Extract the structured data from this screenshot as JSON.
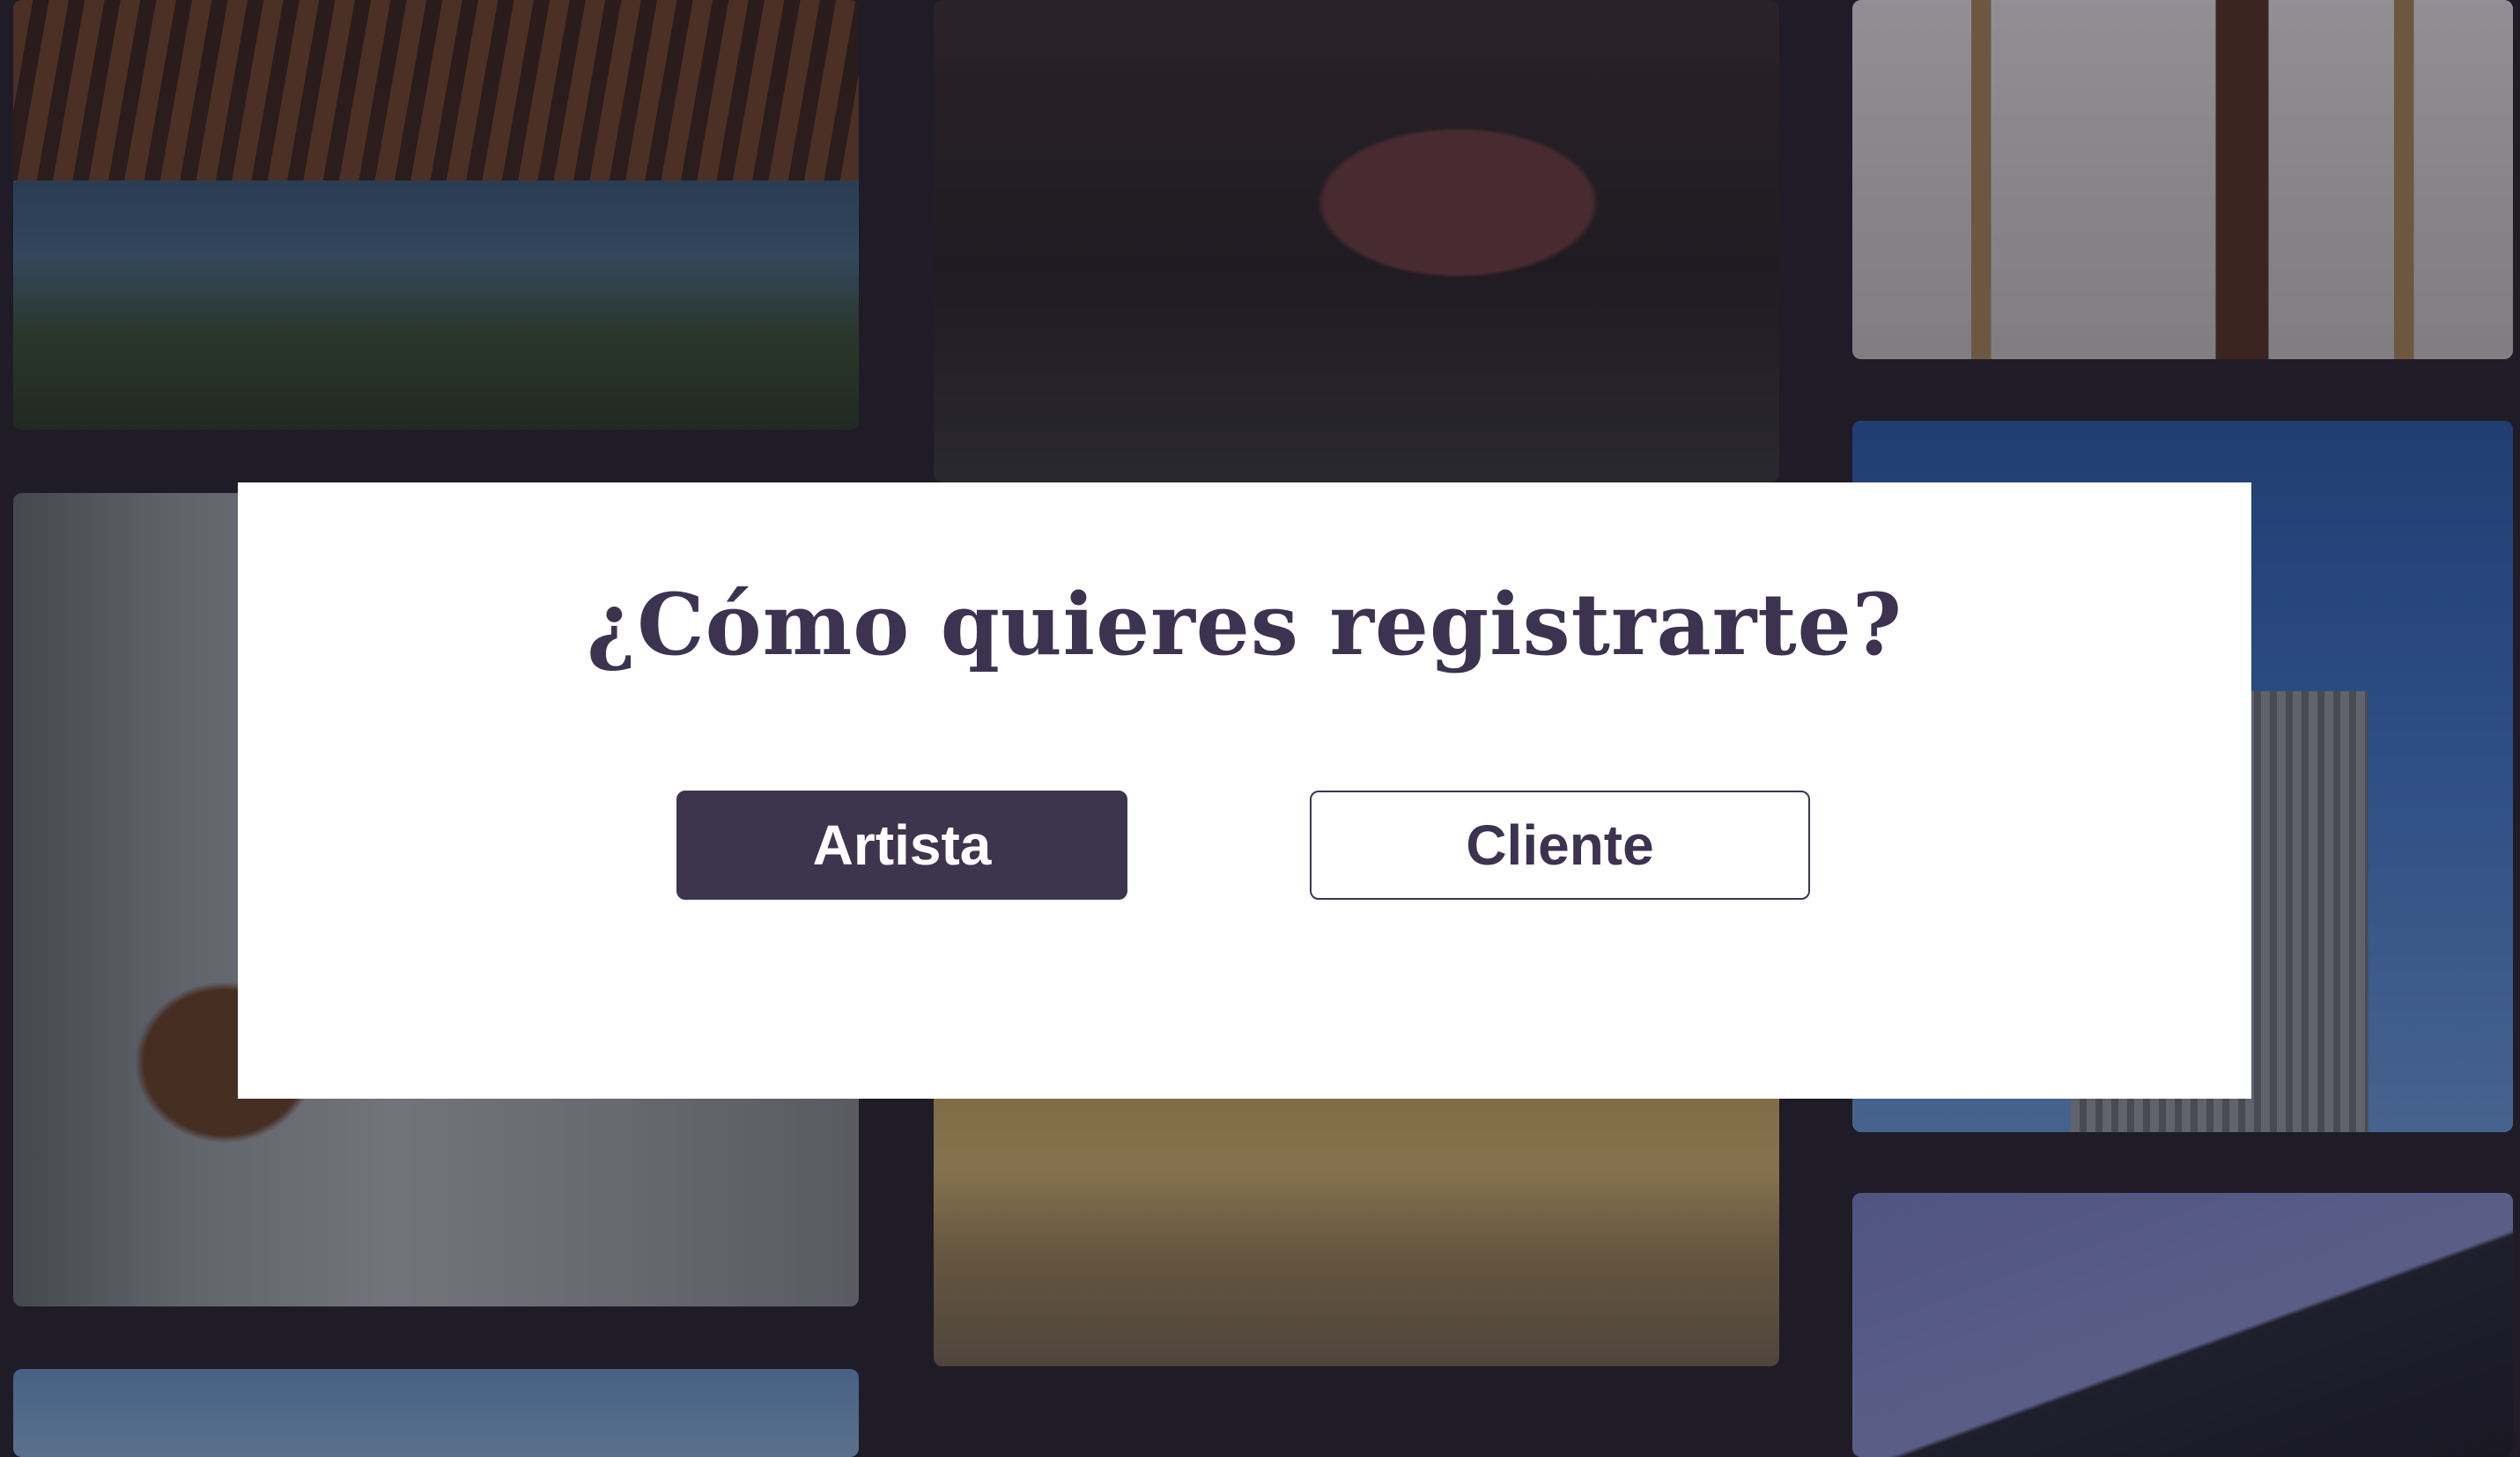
{
  "modal": {
    "title": "¿Cómo quieres registrarte?",
    "buttons": {
      "artist_label": "Artista",
      "client_label": "Cliente"
    }
  },
  "colors": {
    "primary": "#3d344d",
    "title_text": "#3b3350",
    "modal_background": "#ffffff",
    "page_background": "#1f1c27"
  },
  "background_images": [
    {
      "name": "glass-building-with-wood-slats"
    },
    {
      "name": "chair-by-sofa-interior"
    },
    {
      "name": "blue-sky-tree"
    },
    {
      "name": "dark-armchair-interior"
    },
    {
      "name": "japanese-style-interior"
    },
    {
      "name": "white-room-with-shelves"
    },
    {
      "name": "tall-building-blue-sky"
    },
    {
      "name": "purple-sky-building-corner"
    }
  ]
}
